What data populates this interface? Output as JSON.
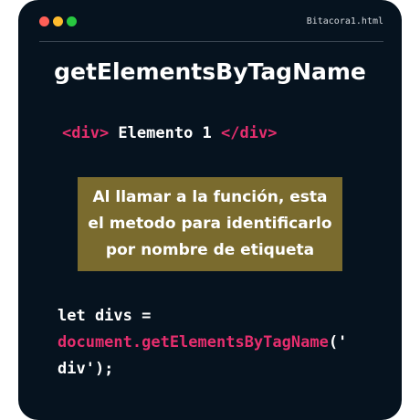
{
  "window": {
    "filename": "Bitacora1.html",
    "dots": [
      {
        "name": "close",
        "color": "#ff5f57"
      },
      {
        "name": "minimize",
        "color": "#febc2e"
      },
      {
        "name": "maximize",
        "color": "#28c840"
      }
    ]
  },
  "title": "getElementsByTagName",
  "html_example": {
    "open_tag": "<div>",
    "content": " Elemento 1 ",
    "close_tag": "</div>"
  },
  "note": {
    "lines": [
      "Al llamar a la función, esta",
      "el metodo para identificarlo",
      "por nombre de etiqueta"
    ]
  },
  "js_example": {
    "line1": "let divs =",
    "line2_fn": "document.getElementsByTagName",
    "line2_rest": "('",
    "line3": "div');"
  },
  "colors": {
    "background": "#06131f",
    "accent": "#e62e6e",
    "note_bg": "#7a6b2e"
  }
}
